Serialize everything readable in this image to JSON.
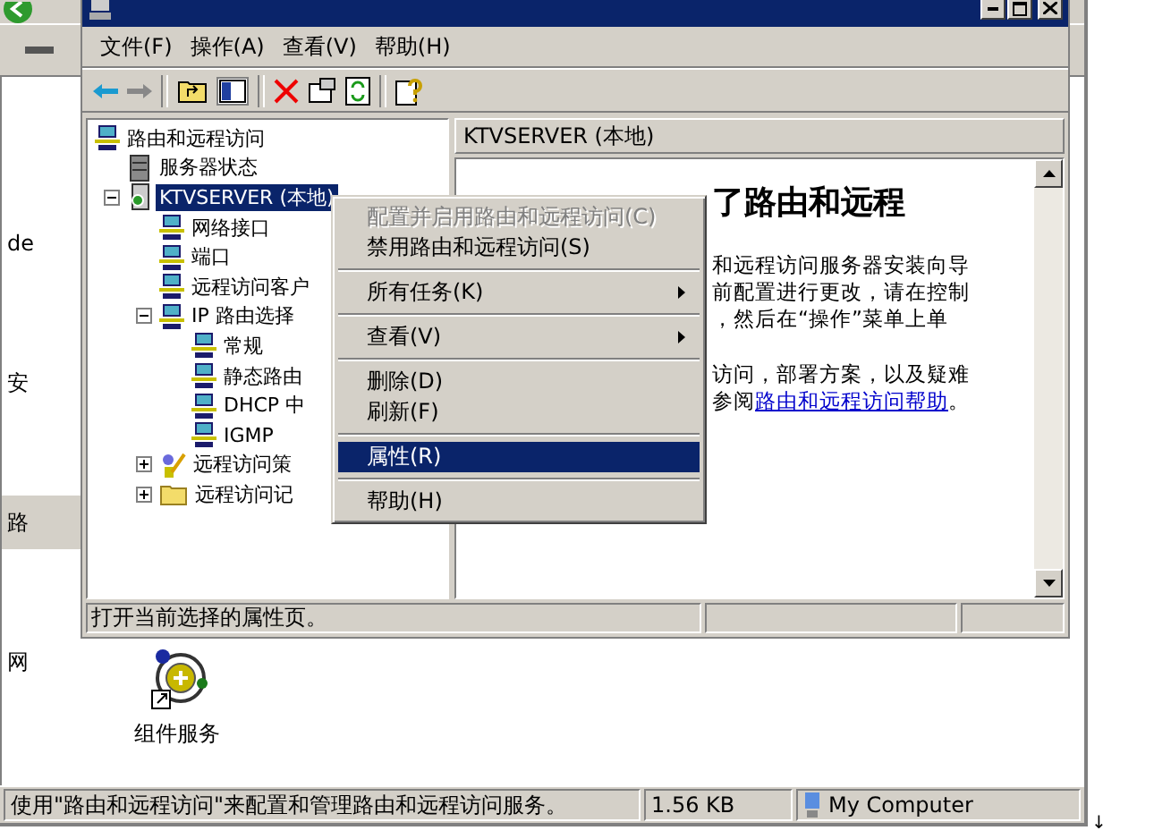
{
  "explorer": {
    "nav_items": [
      {
        "label": "de",
        "selected": false
      },
      {
        "label": "安",
        "selected": false
      },
      {
        "label": "路",
        "selected": true
      },
      {
        "label": "网",
        "selected": false
      }
    ],
    "desktop_icon": {
      "label": "组件服务"
    },
    "status_bar": {
      "message": "使用\"路由和远程访问\"来配置和管理路由和远程访问服务。",
      "size": "1.56 KB",
      "zone": "My Computer"
    }
  },
  "mmc": {
    "menu": [
      "文件(F)",
      "操作(A)",
      "查看(V)",
      "帮助(H)"
    ],
    "tree": [
      {
        "label": "路由和远程访问",
        "kind": "computer",
        "selected": false,
        "children": [
          {
            "label": "服务器状态",
            "kind": "status",
            "selected": false
          },
          {
            "label": "KTVSERVER (本地)",
            "kind": "server",
            "selected": true,
            "expanded": true,
            "children": [
              {
                "label": "网络接口",
                "kind": "computer",
                "selected": false
              },
              {
                "label": "端口",
                "kind": "computer",
                "selected": false
              },
              {
                "label": "远程访问客户",
                "kind": "computer",
                "selected": false
              },
              {
                "label": "IP 路由选择",
                "kind": "computer",
                "selected": false,
                "expanded": true,
                "children": [
                  {
                    "label": "常规",
                    "kind": "computer",
                    "selected": false
                  },
                  {
                    "label": "静态路由",
                    "kind": "computer",
                    "selected": false
                  },
                  {
                    "label": "DHCP 中",
                    "kind": "computer",
                    "selected": false
                  },
                  {
                    "label": "IGMP",
                    "kind": "computer",
                    "selected": false
                  }
                ]
              },
              {
                "label": "远程访问策",
                "kind": "policy",
                "selected": false,
                "expanded": false
              },
              {
                "label": "远程访问记",
                "kind": "folder",
                "selected": false,
                "expanded": false
              }
            ]
          }
        ]
      }
    ],
    "detail": {
      "header": "KTVSERVER (本地)",
      "heading": "了路由和远程",
      "paragraph_1": [
        "和远程访问服务器安装向导",
        "前配置进行更改，请在控制",
        "，然后在“操作”菜单上单"
      ],
      "paragraph_2": {
        "line": "访问，部署方案，以及疑难",
        "prefix": "参阅",
        "link": "路由和远程访问帮助",
        "suffix": "。"
      }
    },
    "status_bar": "打开当前选择的属性页。"
  },
  "context_menu": [
    {
      "kind": "item",
      "label": "配置并启用路由和远程访问(C)",
      "disabled": true,
      "selected": false,
      "submenu": false
    },
    {
      "kind": "item",
      "label": "禁用路由和远程访问(S)",
      "disabled": false,
      "selected": false,
      "submenu": false
    },
    {
      "kind": "separator"
    },
    {
      "kind": "item",
      "label": "所有任务(K)",
      "disabled": false,
      "selected": false,
      "submenu": true
    },
    {
      "kind": "separator"
    },
    {
      "kind": "item",
      "label": "查看(V)",
      "disabled": false,
      "selected": false,
      "submenu": true
    },
    {
      "kind": "separator"
    },
    {
      "kind": "item",
      "label": "删除(D)",
      "disabled": false,
      "selected": false,
      "submenu": false
    },
    {
      "kind": "item",
      "label": "刷新(F)",
      "disabled": false,
      "selected": false,
      "submenu": false
    },
    {
      "kind": "separator"
    },
    {
      "kind": "item",
      "label": "属性(R)",
      "disabled": false,
      "selected": true,
      "submenu": false
    },
    {
      "kind": "separator"
    },
    {
      "kind": "item",
      "label": "帮助(H)",
      "disabled": false,
      "selected": false,
      "submenu": false
    }
  ],
  "stray_mark": "↓"
}
